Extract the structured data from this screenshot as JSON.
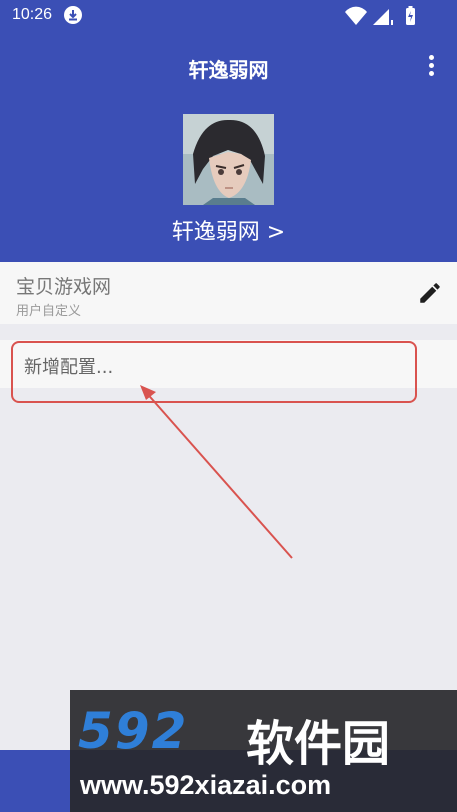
{
  "status_bar": {
    "time": "10:26"
  },
  "header": {
    "title": "轩逸弱网",
    "profile_name": "轩逸弱网 >"
  },
  "user_row": {
    "title": "宝贝游戏网",
    "subtitle": "用户自定义"
  },
  "add_row": {
    "label": "新增配置..."
  },
  "watermark": {
    "logo": "592",
    "brand": "软件园",
    "url": "www.592xiazai.com"
  },
  "colors": {
    "primary": "#3b4fb5",
    "background": "#ebebf0",
    "highlight": "#d9534f"
  },
  "icons": [
    "download-icon",
    "wifi-icon",
    "signal-icon",
    "battery-icon",
    "more-vert-icon",
    "edit-icon"
  ]
}
